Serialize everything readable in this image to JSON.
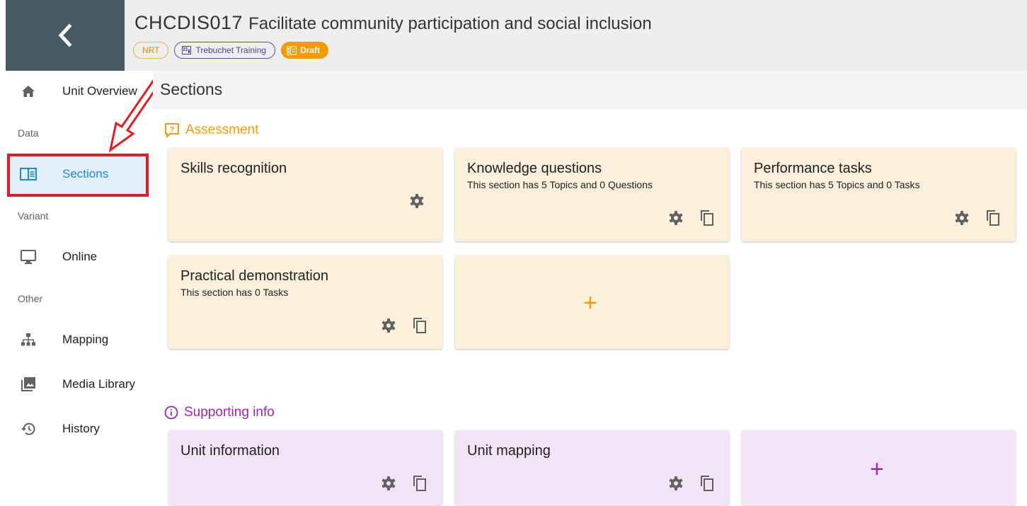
{
  "header": {
    "unit_code": "CHCDIS017",
    "unit_name": "Facilitate community participation and social inclusion",
    "chips": {
      "nrt": "NRT",
      "org": "Trebuchet Training",
      "status": "Draft"
    }
  },
  "sidebar": {
    "items": {
      "overview": "Unit Overview",
      "sections": "Sections",
      "online": "Online",
      "mapping": "Mapping",
      "media": "Media Library",
      "history": "History"
    },
    "groups": {
      "data": "Data",
      "variant": "Variant",
      "other": "Other"
    }
  },
  "main": {
    "title": "Sections",
    "assessment": {
      "heading": "Assessment",
      "cards": [
        {
          "title": "Skills recognition",
          "subtitle": ""
        },
        {
          "title": "Knowledge questions",
          "subtitle": "This section has 5 Topics and 0 Questions"
        },
        {
          "title": "Performance tasks",
          "subtitle": "This section has 5 Topics and 0 Tasks"
        },
        {
          "title": "Practical demonstration",
          "subtitle": "This section has 0 Tasks"
        }
      ],
      "add_label": "+"
    },
    "supporting": {
      "heading": "Supporting info",
      "cards": [
        {
          "title": "Unit information"
        },
        {
          "title": "Unit mapping"
        }
      ],
      "add_label": "+"
    }
  },
  "colors": {
    "accent_blue": "#1e88e5",
    "assessment_orange": "#f5a000",
    "supporting_purple": "#9c27b0",
    "highlight_red": "#e41b22",
    "header_dark": "#465a64"
  }
}
